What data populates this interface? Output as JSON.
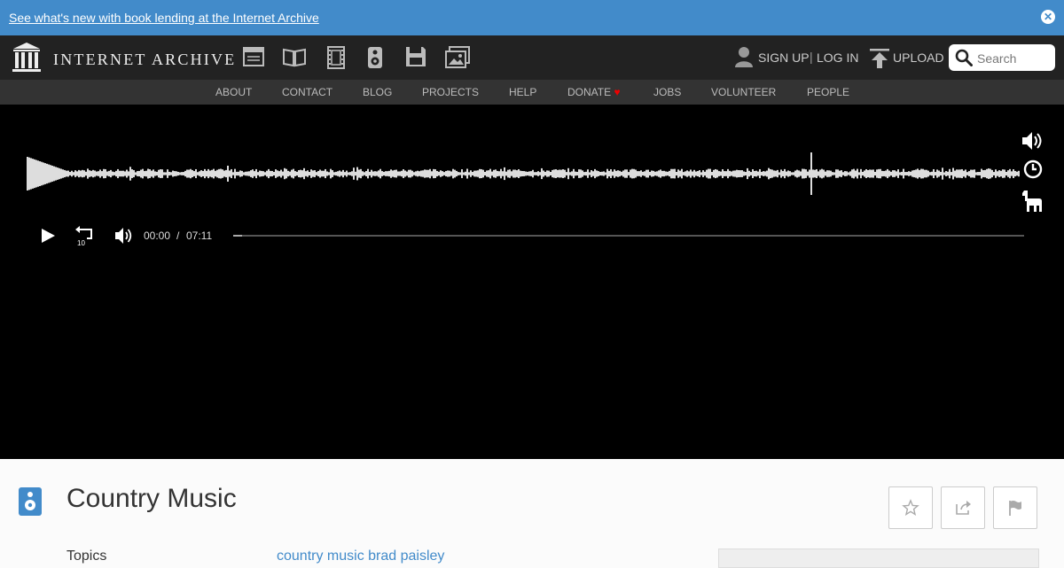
{
  "banner": {
    "text": "See what's new with book lending at the Internet Archive",
    "close_label": "✕"
  },
  "header": {
    "logo_text": "INTERNET ARCHIVE",
    "media_icons": [
      "web-icon",
      "texts-icon",
      "video-icon",
      "audio-icon",
      "software-icon",
      "images-icon"
    ],
    "sign_up": "SIGN UP",
    "separator": "|",
    "log_in": "LOG IN",
    "upload": "UPLOAD",
    "search": {
      "placeholder": "Search",
      "value": ""
    }
  },
  "subnav": {
    "items": [
      "ABOUT",
      "CONTACT",
      "BLOG",
      "PROJECTS",
      "HELP",
      "DONATE",
      "JOBS",
      "VOLUNTEER",
      "PEOPLE"
    ],
    "donate_heart": "♥"
  },
  "player": {
    "current_time": "00:00",
    "time_separator": "/",
    "duration": "07:11",
    "progress_fraction": 0.011
  },
  "item": {
    "title": "Country Music",
    "metadata": [
      {
        "label": "Topics",
        "value": "country music brad paisley"
      }
    ]
  },
  "colors": {
    "banner": "#428bca",
    "nav": "#222222",
    "subnav": "#333333",
    "player": "#000000",
    "link": "#428bca"
  }
}
